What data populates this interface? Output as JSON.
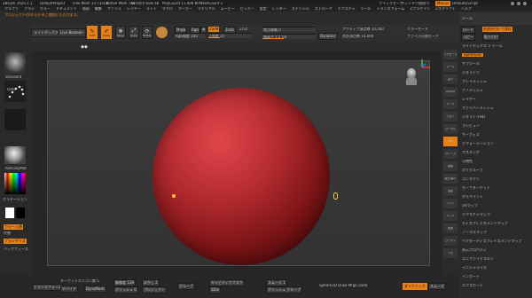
{
  "titlebar": {
    "title": "ZBrush 2020.1.1",
    "project": "DefaultProject",
    "free_mem": "Free Mem 13.735GB",
    "active_mem": "Active Mem 748",
    "scratch_disk": "Scratch Disk 48",
    "polycount": "PolyCount 11.000 KP",
    "meshcount": "MeshCount 1",
    "menus_label": "Menus",
    "script_label": "DefaultZScript",
    "quicksave": "クイックセーブ",
    "see_through": "ウィンドウ透過 0"
  },
  "menubar": {
    "items": [
      "アルファ",
      "ブラシ",
      "カラー",
      "ドキュメント",
      "描画",
      "編集",
      "ファイル",
      "レイヤー",
      "ライト",
      "マクロ",
      "マーカー",
      "マテリアル",
      "ムービー",
      "ピッカー",
      "設定",
      "レンダー",
      "ステンシル",
      "ストローク",
      "テクスチャ",
      "ツール",
      "トランスフォーム",
      "Zプラグイン",
      "Zスクリプト",
      "ヘルプ"
    ]
  },
  "notice": "プロジェクトのUI (日) をご使用いただけます。",
  "toolbar": {
    "lightbox": "ライトボックス",
    "liveboolean": "Live Boolean",
    "edit": "Edit",
    "draw": "Draw",
    "move": "Move",
    "scale": "Scale",
    "rotate": "Rotate",
    "mrgb": "Mrgb",
    "rgb": "Rgb",
    "m": "M",
    "zadd": "Zadd",
    "zsub": "Zsub",
    "zcut": "Zcut",
    "rgb_intensity": "Rgb強度 100",
    "z_intensity": "Z強度 25",
    "focal_shift": "焦点移動 0",
    "draw_size": "描画サイズ 64",
    "dynamic": "Dynamic",
    "active_points": "アクティブ頂点数 10,000",
    "total_points": "合計頂点数 10,000",
    "mirror": "ミラーモード",
    "symmetry": "ミラーモード 45,78237",
    "split_mode": "ファイル分割モード"
  },
  "left_panel": {
    "brush": "Standard",
    "stroke": "Dots",
    "alpha": "Alpha Off",
    "texture": "Texture Off",
    "material": "RedClayMat",
    "gradient": "グラデーション",
    "switch_color": "カラー入替",
    "alternate": "代替",
    "swatch_label": "ブラシサイズ",
    "backface": "バックフェース",
    "foreground": "前景",
    "background": "背景",
    "color_fg": "#ffffff",
    "color_bg": "#000000"
  },
  "right_tools": {
    "labels": [
      "スクロール",
      "ズーム",
      "実寸",
      "AAHalf",
      "パース",
      "フロア",
      "ローカル",
      "XYZ",
      "フレーム",
      "移動",
      "拡大/縮小",
      "回転",
      "ライン",
      "フィル",
      "透過",
      "ゴースト",
      "ソロ"
    ]
  },
  "right_panel": {
    "header": "ツール",
    "load": "ロード",
    "save_as": "名前を付けて保存",
    "copy": "コピー",
    "paste": "貼り付け",
    "import": "インポート",
    "export": "エクスポート",
    "clone": "複製",
    "make_polymesh": "PolyMesh3Dに変換",
    "goz": "GoZ",
    "all": "全て",
    "visible": "表示",
    "r": "R",
    "lightbox_tools": "ライトボックス > ツール",
    "sphere3d": "Sphere3D",
    "subtool": "サブツール",
    "geometry": "ジオメトリ",
    "arraymesh": "アレイメッシュ",
    "nanomesh": "ナノメッシュ",
    "layers": "レイヤー",
    "fibermesh": "ファイバーメッシュ",
    "geometry_hd": "ジオメトリHD",
    "preview": "プレビュー",
    "surface": "サーフェス",
    "deformation": "デフォーメーション",
    "masking": "マスキング",
    "visibility": "可視性",
    "polygroups": "ポリグループ",
    "contact": "コンタクト",
    "morph_target": "モーフターゲット",
    "polypaint": "ポリペイント",
    "uv_map": "UVマップ",
    "texture_map": "テクスチャマップ",
    "displacement_map": "ディスプレイスメントマップ",
    "normal_map": "ノーマルマップ",
    "vector_displacement": "ベクターディスプレイスメントマップ",
    "display_properties": "表示プロパティ",
    "unified_skin": "ユニファイドスキン",
    "initialize": "イニシャライズ",
    "import2": "インポート",
    "export2": "エクスポート"
  },
  "bottom_bar": {
    "items": [
      "トランスフォーム",
      "ポイントライト",
      "ライト",
      "ジオメトリ",
      "マスク",
      "マスク",
      "ジオメトリ",
      "Zリメッシャー",
      "クリア",
      "ソフト",
      "スクロール",
      "メッシュの統合",
      "最適化",
      "カラー",
      "ポリペイント",
      "デバイド",
      "ダイナミック",
      "ダイナミクス",
      "カラーを塗る",
      "スムーズ",
      "ズーム",
      "アクティブ"
    ],
    "zremesher_target": "ターゲットポリゴン数 5",
    "divide": "デバイド",
    "dynamesh": "DynaMesh",
    "resolution": "解像度 128",
    "polish": "ポリッシュ 0",
    "blur": "ぼかし 2",
    "project": "プロジェクト",
    "groups": "グループ",
    "mask_by_cavity": "キャビティでマスク",
    "sdiv": "SDiv",
    "smooth_level": "スムーズ 1",
    "polishing": "ポリッシュ グループ"
  },
  "status_bottom": "Sphere3D  Draw  Mrgb  Zadd"
}
